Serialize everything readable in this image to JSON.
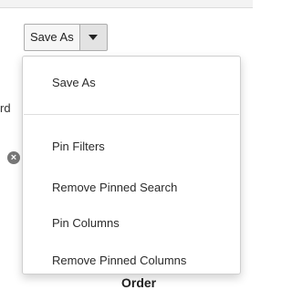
{
  "toolbar": {
    "save_as_label": "Save As"
  },
  "background": {
    "partial_text": "rd",
    "clear_icon_glyph": "×",
    "partial_heading": "Order"
  },
  "menu": {
    "items": [
      {
        "label": "Save As"
      },
      {
        "label": "Pin Filters"
      },
      {
        "label": "Remove Pinned Search"
      },
      {
        "label": "Pin Columns"
      },
      {
        "label": "Remove Pinned Columns"
      }
    ]
  }
}
